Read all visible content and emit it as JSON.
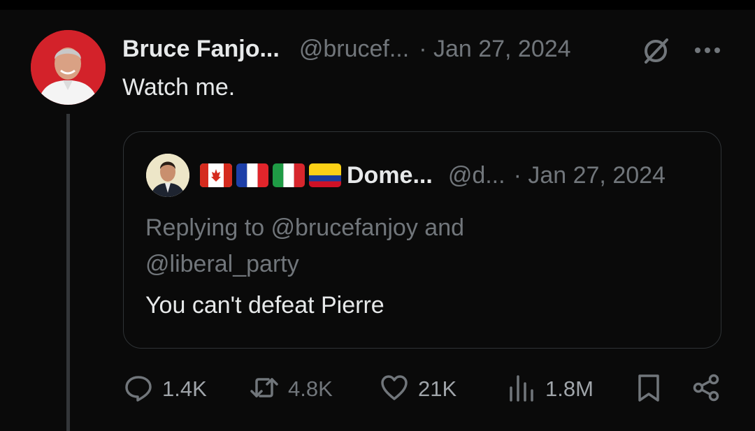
{
  "tweet": {
    "author_name": "Bruce Fanjo...",
    "handle": "@brucef...",
    "date": "· Jan 27, 2024",
    "text": "Watch me."
  },
  "quoted_tweet": {
    "flags": [
      "canada",
      "france",
      "italy",
      "colombia"
    ],
    "author_name": "Dome...",
    "handle": "@d...",
    "date": "· Jan 27, 2024",
    "replying_line1": "Replying to @brucefanjoy and",
    "replying_line2": "@liberal_party",
    "text": "You can't defeat Pierre"
  },
  "actions": {
    "replies": "1.4K",
    "reposts": "4.8K",
    "likes": "21K",
    "views": "1.8M"
  },
  "icons": [
    "grok-icon",
    "more-icon",
    "reply-icon",
    "repost-icon",
    "like-icon",
    "views-icon",
    "bookmark-icon",
    "share-icon"
  ],
  "colors": {
    "background": "#0a0a0a",
    "text": "#e7e9ea",
    "muted": "#71767b",
    "border": "#2f3336"
  }
}
